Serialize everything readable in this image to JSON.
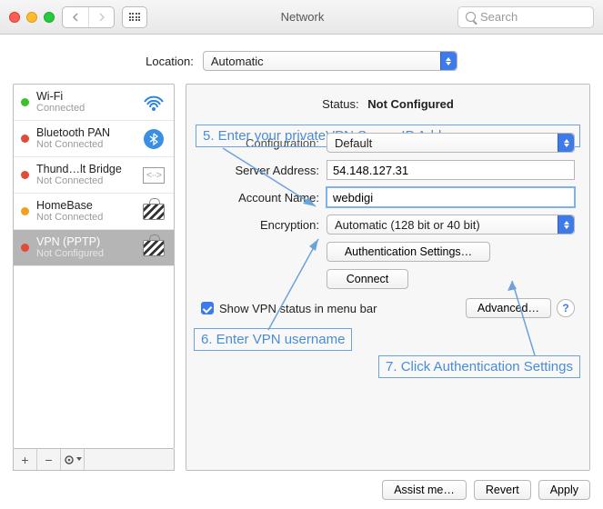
{
  "window": {
    "title": "Network",
    "search_placeholder": "Search"
  },
  "location": {
    "label": "Location:",
    "value": "Automatic"
  },
  "sidebar": {
    "items": [
      {
        "name": "Wi-Fi",
        "sub": "Connected",
        "status": "green",
        "icon": "wifi"
      },
      {
        "name": "Bluetooth PAN",
        "sub": "Not Connected",
        "status": "red",
        "icon": "bluetooth"
      },
      {
        "name": "Thund…lt Bridge",
        "sub": "Not Connected",
        "status": "red",
        "icon": "thunderbolt"
      },
      {
        "name": "HomeBase",
        "sub": "Not Connected",
        "status": "orange",
        "icon": "vpn"
      },
      {
        "name": "VPN (PPTP)",
        "sub": "Not Configured",
        "status": "red",
        "icon": "vpn",
        "selected": true
      }
    ]
  },
  "detail": {
    "status_label": "Status:",
    "status_value": "Not Configured",
    "config_label": "Configuration:",
    "config_value": "Default",
    "server_label": "Server Address:",
    "server_value": "54.148.127.31",
    "account_label": "Account Name:",
    "account_value": "webdigi",
    "encryption_label": "Encryption:",
    "encryption_value": "Automatic (128 bit or 40 bit)",
    "auth_button": "Authentication Settings…",
    "connect_button": "Connect",
    "show_status_label": "Show VPN status in menu bar",
    "advanced_button": "Advanced…"
  },
  "footer": {
    "assist": "Assist me…",
    "revert": "Revert",
    "apply": "Apply"
  },
  "annotations": {
    "step5": "5. Enter your privateVPN Server IP Address",
    "step6": "6. Enter VPN username",
    "step7": "7. Click Authentication Settings"
  }
}
